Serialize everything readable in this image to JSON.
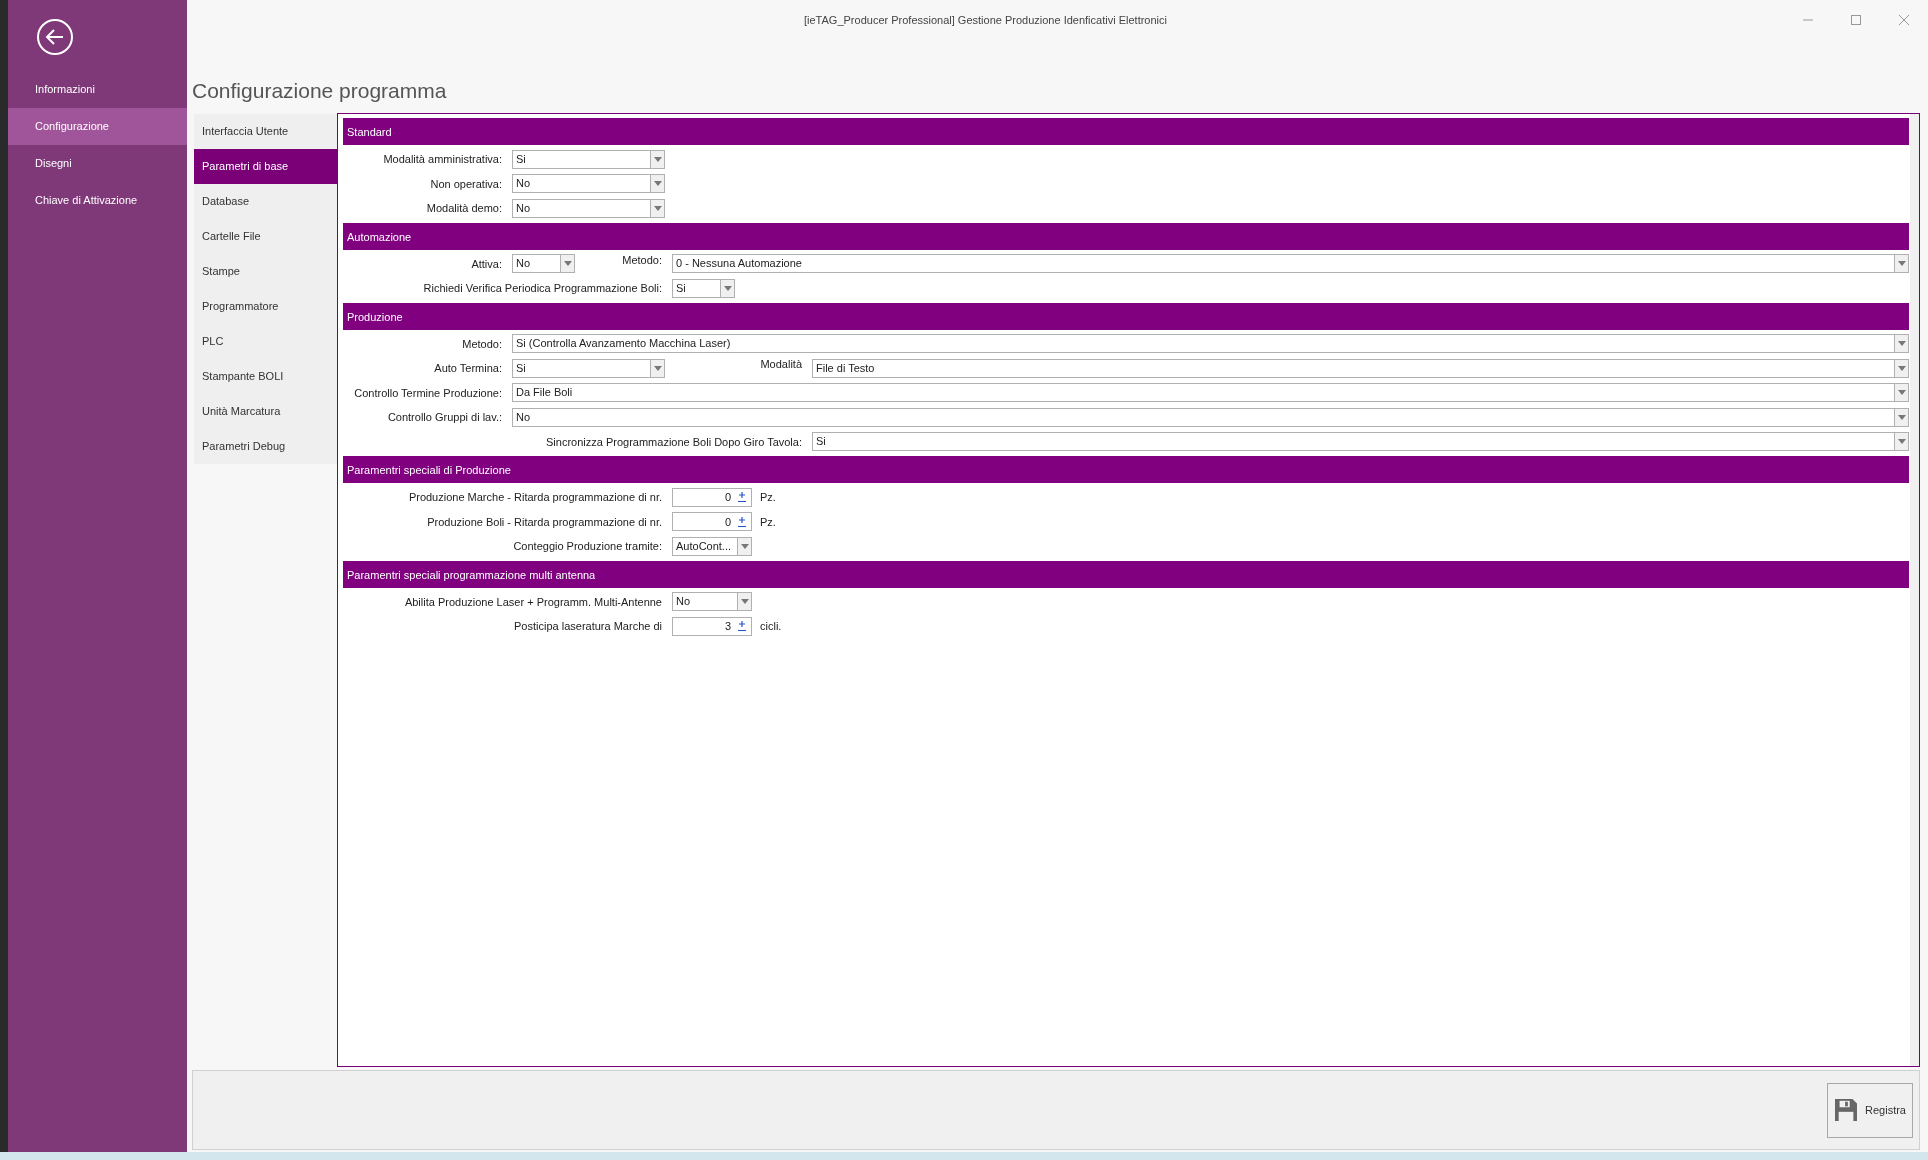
{
  "window": {
    "title": "[ieTAG_Producer Professional] Gestione Produzione Idenficativi Elettronici"
  },
  "sidebar": {
    "items": [
      {
        "label": "Informazioni",
        "selected": false
      },
      {
        "label": "Configurazione",
        "selected": true
      },
      {
        "label": "Disegni",
        "selected": false
      },
      {
        "label": "Chiave di Attivazione",
        "selected": false
      }
    ]
  },
  "page_title": "Configurazione programma",
  "tabs": [
    {
      "label": "Interfaccia Utente",
      "selected": false
    },
    {
      "label": "Parametri di base",
      "selected": true
    },
    {
      "label": "Database",
      "selected": false
    },
    {
      "label": "Cartelle File",
      "selected": false
    },
    {
      "label": "Stampe",
      "selected": false
    },
    {
      "label": "Programmatore",
      "selected": false
    },
    {
      "label": "PLC",
      "selected": false
    },
    {
      "label": "Stampante BOLI",
      "selected": false
    },
    {
      "label": "Unità Marcatura",
      "selected": false
    },
    {
      "label": "Parametri Debug",
      "selected": false
    }
  ],
  "sections": [
    {
      "title": "Standard",
      "rows": [
        [
          {
            "label": "Modalità amministrativa:",
            "kind": "dropdown",
            "value": "Si"
          }
        ],
        [
          {
            "label": "Non operativa:",
            "kind": "dropdown",
            "value": "No"
          }
        ],
        [
          {
            "label": "Modalità demo:",
            "kind": "dropdown",
            "value": "No"
          }
        ]
      ]
    },
    {
      "title": "Automazione",
      "rows": [
        [
          {
            "label": "Attiva:",
            "kind": "dropdown",
            "value": "No"
          },
          {
            "label": "Metodo:",
            "kind": "wide-dropdown",
            "value": "0 - Nessuna Automazione"
          }
        ],
        [
          {
            "label": "Richiedi Verifica Periodica Programmazione Boli:",
            "kind": "dropdown",
            "value": "Si"
          }
        ]
      ]
    },
    {
      "title": "Produzione",
      "rows": [
        [
          {
            "label": "Metodo:",
            "kind": "wide-dropdown",
            "value": "Si (Controlla Avanzamento Macchina Laser)"
          }
        ],
        [
          {
            "label": "Auto Termina:",
            "kind": "dropdown",
            "value": "Si"
          },
          {
            "label": "Modalità",
            "kind": "wide-dropdown",
            "value": "File di Testo"
          }
        ],
        [
          {
            "label": "Controllo Termine Produzione:",
            "kind": "wide-dropdown",
            "value": "Da File Boli"
          }
        ],
        [
          {
            "label": "Controllo Gruppi di lav.:",
            "kind": "wide-dropdown",
            "value": "No"
          }
        ],
        [
          {
            "label": "Sincronizza Programmazione Boli Dopo Giro Tavola:",
            "kind": "wide-dropdown",
            "value": "Si"
          }
        ]
      ]
    },
    {
      "title": "Paramentri speciali di Produzione",
      "rows": [
        [
          {
            "label": "Produzione Marche - Ritarda programmazione di nr.",
            "kind": "spinner",
            "value": "0",
            "unit": "Pz."
          }
        ],
        [
          {
            "label": "Produzione Boli - Ritarda programmazione di nr.",
            "kind": "spinner",
            "value": "0",
            "unit": "Pz."
          }
        ],
        [
          {
            "label": "Conteggio Produzione tramite:",
            "kind": "dropdown",
            "value": "AutoCont..."
          }
        ]
      ]
    },
    {
      "title": "Paramentri speciali programmazione multi antenna",
      "rows": [
        [
          {
            "label": "Abilita Produzione Laser + Programm. Multi-Antenne",
            "kind": "dropdown",
            "value": "No"
          }
        ],
        [
          {
            "label": "Posticipa laseratura Marche di",
            "kind": "spinner",
            "value": "3",
            "unit": "cicli."
          }
        ]
      ]
    }
  ],
  "save_button": {
    "label": "Registra"
  }
}
